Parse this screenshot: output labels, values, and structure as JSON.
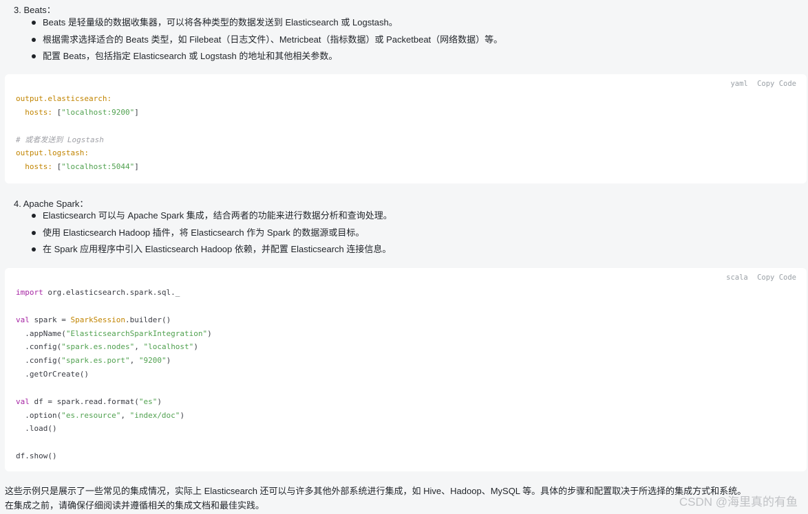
{
  "beats": {
    "title": "3. Beats：",
    "bullets": [
      "Beats 是轻量级的数据收集器，可以将各种类型的数据发送到 Elasticsearch 或 Logstash。",
      "根据需求选择适合的 Beats 类型，如 Filebeat（日志文件）、Metricbeat（指标数据）或 Packetbeat（网络数据）等。",
      "配置 Beats，包括指定 Elasticsearch 或 Logstash 的地址和其他相关参数。"
    ],
    "code": {
      "lang": "yaml",
      "copy_label": "Copy",
      "code_label": "Code",
      "lines": [
        [
          {
            "t": "output.elasticsearch:",
            "c": "kf"
          }
        ],
        [
          {
            "t": "  hosts: ",
            "c": "kf"
          },
          {
            "t": "[",
            "c": ""
          },
          {
            "t": "\"localhost:9200\"",
            "c": "s"
          },
          {
            "t": "]",
            "c": ""
          }
        ],
        [
          {
            "t": "",
            "c": ""
          }
        ],
        [
          {
            "t": "# 或者发送到 Logstash",
            "c": "c"
          }
        ],
        [
          {
            "t": "output.logstash:",
            "c": "kf"
          }
        ],
        [
          {
            "t": "  hosts: ",
            "c": "kf"
          },
          {
            "t": "[",
            "c": ""
          },
          {
            "t": "\"localhost:5044\"",
            "c": "s"
          },
          {
            "t": "]",
            "c": ""
          }
        ]
      ]
    }
  },
  "spark": {
    "title": "4. Apache Spark：",
    "bullets": [
      "Elasticsearch 可以与 Apache Spark 集成，结合两者的功能来进行数据分析和查询处理。",
      "使用 Elasticsearch Hadoop 插件，将 Elasticsearch 作为 Spark 的数据源或目标。",
      "在 Spark 应用程序中引入 Elasticsearch Hadoop 依赖，并配置 Elasticsearch 连接信息。"
    ],
    "code": {
      "lang": "scala",
      "copy_label": "Copy",
      "code_label": "Code",
      "lines": [
        [
          {
            "t": "import",
            "c": "k"
          },
          {
            "t": " org.elasticsearch.spark.sql._",
            "c": ""
          }
        ],
        [
          {
            "t": "",
            "c": ""
          }
        ],
        [
          {
            "t": "val",
            "c": "k"
          },
          {
            "t": " spark = ",
            "c": ""
          },
          {
            "t": "SparkSession",
            "c": "kf"
          },
          {
            "t": ".builder()",
            "c": ""
          }
        ],
        [
          {
            "t": "  .appName(",
            "c": ""
          },
          {
            "t": "\"ElasticsearchSparkIntegration\"",
            "c": "s"
          },
          {
            "t": ")",
            "c": ""
          }
        ],
        [
          {
            "t": "  .config(",
            "c": ""
          },
          {
            "t": "\"spark.es.nodes\"",
            "c": "s"
          },
          {
            "t": ", ",
            "c": ""
          },
          {
            "t": "\"localhost\"",
            "c": "s"
          },
          {
            "t": ")",
            "c": ""
          }
        ],
        [
          {
            "t": "  .config(",
            "c": ""
          },
          {
            "t": "\"spark.es.port\"",
            "c": "s"
          },
          {
            "t": ", ",
            "c": ""
          },
          {
            "t": "\"9200\"",
            "c": "s"
          },
          {
            "t": ")",
            "c": ""
          }
        ],
        [
          {
            "t": "  .getOrCreate()",
            "c": ""
          }
        ],
        [
          {
            "t": "",
            "c": ""
          }
        ],
        [
          {
            "t": "val",
            "c": "k"
          },
          {
            "t": " df = spark.read.format(",
            "c": ""
          },
          {
            "t": "\"es\"",
            "c": "s"
          },
          {
            "t": ")",
            "c": ""
          }
        ],
        [
          {
            "t": "  .option(",
            "c": ""
          },
          {
            "t": "\"es.resource\"",
            "c": "s"
          },
          {
            "t": ", ",
            "c": ""
          },
          {
            "t": "\"index/doc\"",
            "c": "s"
          },
          {
            "t": ")",
            "c": ""
          }
        ],
        [
          {
            "t": "  .load()",
            "c": ""
          }
        ],
        [
          {
            "t": "",
            "c": ""
          }
        ],
        [
          {
            "t": "df.show()",
            "c": ""
          }
        ]
      ]
    }
  },
  "footer": {
    "line1": "这些示例只是展示了一些常见的集成情况，实际上 Elasticsearch 还可以与许多其他外部系统进行集成，如 Hive、Hadoop、MySQL 等。具体的步骤和配置取决于所选择的集成方式和系统。",
    "line2": "在集成之前，请确保仔细阅读并遵循相关的集成文档和最佳实践。"
  },
  "watermark": "CSDN @海里真的有鱼"
}
